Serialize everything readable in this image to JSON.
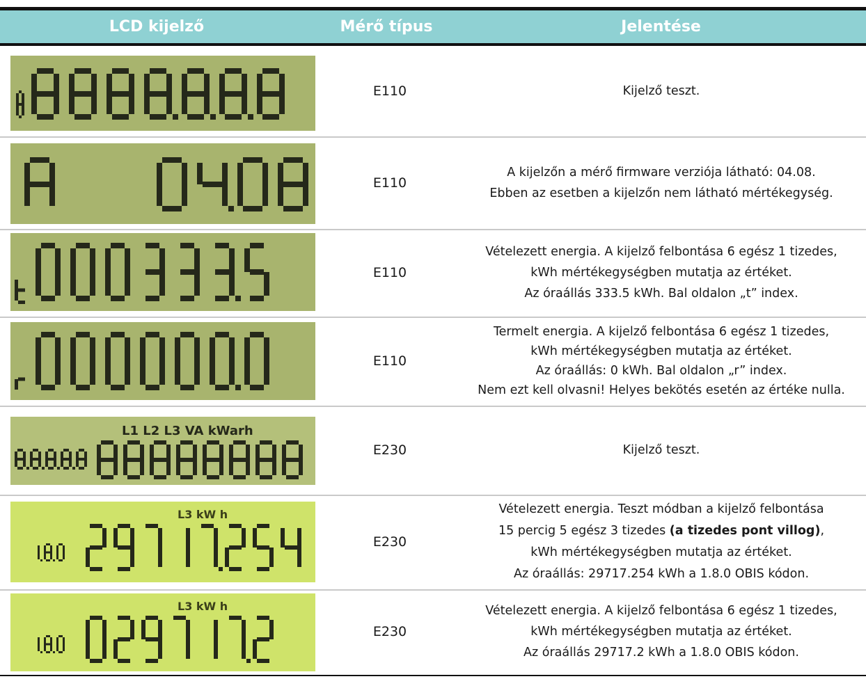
{
  "header": {
    "col_lcd": "LCD kijelző",
    "col_type": "Mérő típus",
    "col_meaning": "Jelentése"
  },
  "rows": [
    {
      "lcd": {
        "prefix": "8",
        "digits": "8888.8.8.8",
        "bg": "#a8b46e"
      },
      "meter": "E110",
      "lines": [
        "Kijelző teszt."
      ]
    },
    {
      "lcd": {
        "prefix": "A",
        "digits": "04.08",
        "bg": "#a8b46e"
      },
      "meter": "E110",
      "lines": [
        "A kijelzőn a mérő firmware verziója látható: 04.08.",
        "Ebben az esetben a kijelzőn nem látható mértékegység."
      ]
    },
    {
      "lcd": {
        "prefix": "t",
        "digits": "000333.5",
        "bg": "#a8b46e"
      },
      "meter": "E110",
      "lines": [
        "Vételezett energia. A kijelző felbontása 6 egész 1 tizedes,",
        "kWh mértékegységben mutatja az értéket.",
        "Az óraállás 333.5 kWh. Bal oldalon „t” index."
      ]
    },
    {
      "lcd": {
        "prefix": "r",
        "digits": "000000.0",
        "bg": "#a8b46e"
      },
      "meter": "E110",
      "lines": [
        "Termelt energia. A kijelző felbontása 6 egész 1 tizedes,",
        "kWh mértékegységben mutatja az értéket.",
        "Az óraállás: 0 kWh. Bal oldalon „r” index.",
        "Nem ezt kell olvasni! Helyes bekötés esetén az értéke nulla."
      ]
    },
    {
      "lcd": {
        "top_labels": "L1 L2 L3 VA kWarh",
        "small": "8.8.8.8.8",
        "digits": "88888888",
        "bg": "#a8b46e"
      },
      "meter": "E230",
      "lines": [
        "Kijelző teszt."
      ]
    },
    {
      "lcd": {
        "top_labels": "L3 kW h",
        "small": "1.8.0",
        "digits": "29717.254",
        "bg": "#cfe36a"
      },
      "meter": "E230",
      "lines": [
        "Vételezett energia. Teszt módban a kijelző felbontása",
        "15 percig 5 egész 3 tizedes",
        "(a tizedes pont villog)",
        ",",
        "kWh mértékegységben mutatja az értéket.",
        "Az óraállás: 29717.254 kWh a 1.8.0 OBIS kódon."
      ]
    },
    {
      "lcd": {
        "top_labels": "L3 kW h",
        "small": "1.8.0",
        "digits": "029717.2",
        "bg": "#cfe36a"
      },
      "meter": "E230",
      "lines": [
        "Vételezett energia. A kijelző felbontása 6 egész 1 tizedes,",
        "kWh mértékegységben mutatja az értéket.",
        "Az óraállás 29717.2 kWh a 1.8.0 OBIS kódon."
      ]
    }
  ]
}
